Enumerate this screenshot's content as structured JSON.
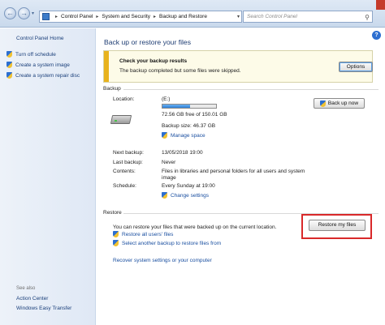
{
  "address": {
    "crumbs": [
      "Control Panel",
      "System and Security",
      "Backup and Restore"
    ],
    "search_placeholder": "Search Control Panel"
  },
  "sidebar": {
    "home": "Control Panel Home",
    "links": [
      "Turn off schedule",
      "Create a system image",
      "Create a system repair disc"
    ],
    "see_also": "See also",
    "see_also_links": [
      "Action Center",
      "Windows Easy Transfer"
    ]
  },
  "main": {
    "title": "Back up or restore your files",
    "notice": {
      "title": "Check your backup results",
      "text": "The backup completed but some files were skipped.",
      "button": "Options"
    },
    "backup": {
      "section": "Backup",
      "location_label": "Location:",
      "location_value": "(E:)",
      "disk_used_fraction": 0.52,
      "free_text": "72.56 GB free of 150.01 GB",
      "size_text": "Backup size: 46.37 GB",
      "manage_space": "Manage space",
      "backup_now": "Back up now",
      "next_label": "Next backup:",
      "next_value": "13/05/2018 19:00",
      "last_label": "Last backup:",
      "last_value": "Never",
      "contents_label": "Contents:",
      "contents_value_1": "Files in libraries and personal folders for all users and system",
      "contents_value_2": "image",
      "schedule_label": "Schedule:",
      "schedule_value": "Every Sunday at 19:00",
      "change_settings": "Change settings"
    },
    "restore": {
      "section": "Restore",
      "text": "You can restore your files that were backed up on the current location.",
      "restore_all": "Restore all users' files",
      "select_another": "Select another backup to restore files from",
      "recover": "Recover system settings or your computer",
      "restore_button": "Restore my files"
    }
  },
  "colors": {
    "accent": "#1a4fa0",
    "warning": "#e8b21c",
    "highlight": "#d9292a"
  }
}
